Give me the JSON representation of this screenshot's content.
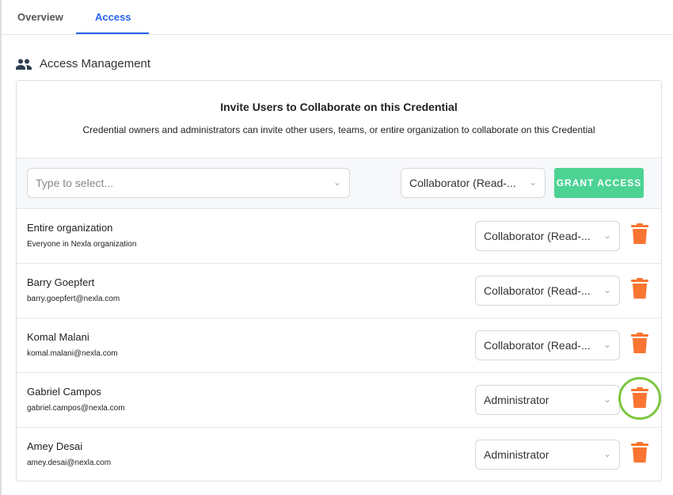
{
  "tabs": [
    {
      "label": "Overview"
    },
    {
      "label": "Access",
      "active": true
    }
  ],
  "section": {
    "title": "Access Management",
    "icon": "people-icon"
  },
  "invite": {
    "title": "Invite Users to Collaborate on this Credential",
    "description": "Credential owners and administrators can invite other users, teams, or entire organization to collaborate on this Credential"
  },
  "toolbar": {
    "user_placeholder": "Type to select...",
    "role_value": "Collaborator (Read-...",
    "grant_label": "GRANT ACCESS"
  },
  "rows": [
    {
      "name": "Entire organization",
      "sub": "Everyone in Nexla organization",
      "role": "Collaborator (Read-..."
    },
    {
      "name": "Barry Goepfert",
      "sub": "barry.goepfert@nexla.com",
      "role": "Collaborator (Read-..."
    },
    {
      "name": "Komal Malani",
      "sub": "komal.malani@nexla.com",
      "role": "Collaborator (Read-..."
    },
    {
      "name": "Gabriel Campos",
      "sub": "gabriel.campos@nexla.com",
      "role": "Administrator",
      "highlighted": true
    },
    {
      "name": "Amey Desai",
      "sub": "amey.desai@nexla.com",
      "role": "Administrator"
    }
  ],
  "colors": {
    "accent": "#2563eb",
    "grant": "#4cd393",
    "trash": "#f97531",
    "highlight": "#7cc63f"
  }
}
